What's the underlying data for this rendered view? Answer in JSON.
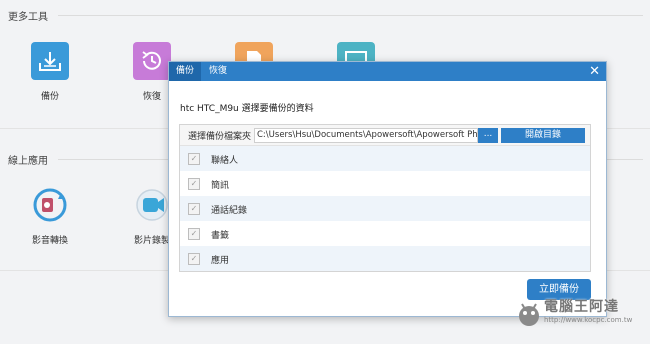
{
  "sections": {
    "more_tools": "更多工具",
    "online_apps": "線上應用"
  },
  "tools": [
    {
      "label": "備份",
      "icon": "backup-tray-icon",
      "color": "#3a9ad9"
    },
    {
      "label": "恢復",
      "icon": "restore-clock-icon",
      "color": "#c77bd8"
    },
    {
      "label": "",
      "icon": "file-icon",
      "color": "#f0a45c"
    },
    {
      "label": "",
      "icon": "monitor-icon",
      "color": "#4db3c4"
    }
  ],
  "online_apps": [
    {
      "label": "影音轉換",
      "icon": "video-convert-icon"
    },
    {
      "label": "影片錄製",
      "icon": "video-record-icon"
    }
  ],
  "dialog": {
    "tabs": [
      "備份",
      "恢復"
    ],
    "active_tab": "備份",
    "heading": "htc HTC_M9u 選擇要備份的資料",
    "path_label": "選擇備份檔案夾",
    "path_value": "C:\\Users\\Hsu\\Documents\\Apowersoft\\Apowersoft Phor",
    "browse_label": "...",
    "open_label": "開啟目錄",
    "items": [
      "聯絡人",
      "簡訊",
      "通話紀錄",
      "書籤",
      "應用"
    ],
    "backup_button": "立即備份",
    "accent": "#2e7fc7"
  },
  "watermark": {
    "title": "電腦王阿達",
    "url": "http://www.kocpc.com.tw"
  }
}
